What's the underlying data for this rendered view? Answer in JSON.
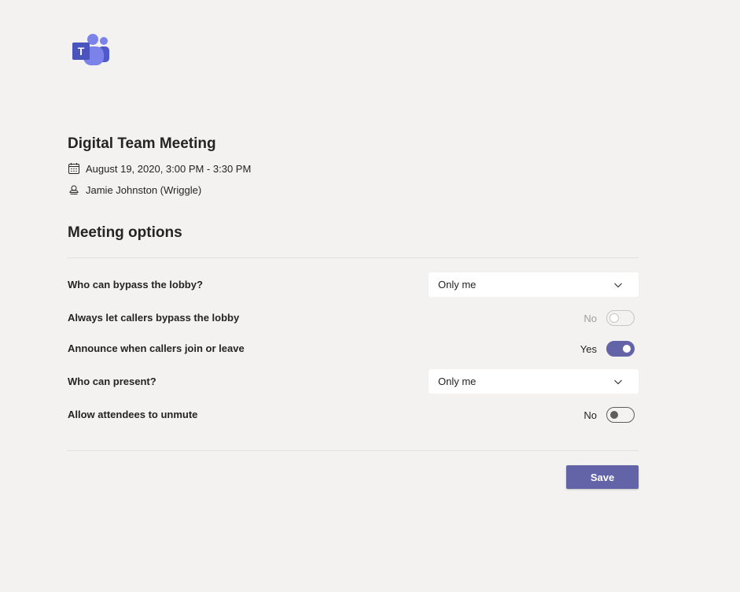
{
  "logo": {
    "icon": "teams-logo",
    "letter": "T"
  },
  "meeting": {
    "title": "Digital Team Meeting",
    "datetime": "August 19, 2020, 3:00 PM - 3:30 PM",
    "organizer": "Jamie Johnston (Wriggle)"
  },
  "options": {
    "title": "Meeting options",
    "bypass_lobby": {
      "label": "Who can bypass the lobby?",
      "value": "Only me"
    },
    "callers_bypass": {
      "label": "Always let callers bypass the lobby",
      "state": "No",
      "enabled": false
    },
    "announce": {
      "label": "Announce when callers join or leave",
      "state": "Yes",
      "on": true
    },
    "present": {
      "label": "Who can present?",
      "value": "Only me"
    },
    "unmute": {
      "label": "Allow attendees to unmute",
      "state": "No",
      "on": false
    }
  },
  "actions": {
    "save_label": "Save"
  },
  "colors": {
    "accent": "#6264a7",
    "background": "#f3f2f1"
  }
}
